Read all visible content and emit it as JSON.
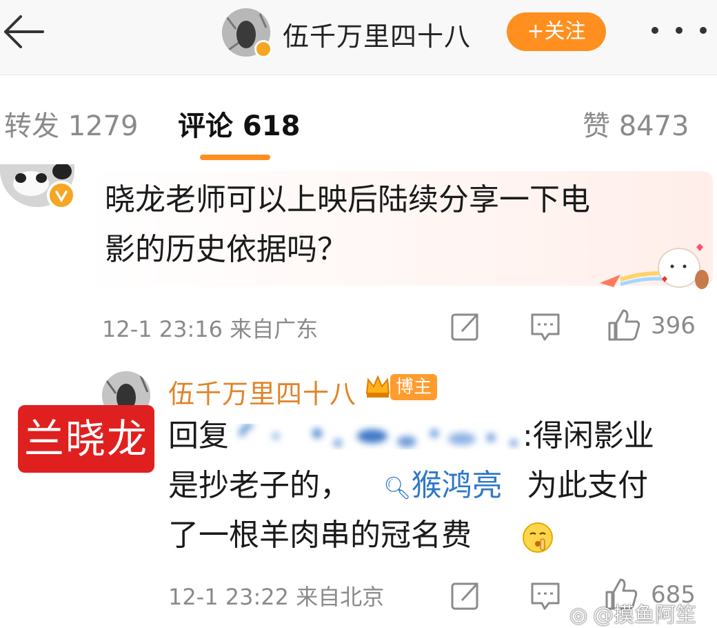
{
  "header": {
    "account_name": "伍千万里四十八",
    "follow_label": "+关注"
  },
  "tabs": {
    "repost": "转发 1279",
    "comments": "评论 618",
    "likes": "赞 8473"
  },
  "comment1": {
    "text_line1": "晓龙老师可以上映后陆续分享一下电",
    "text_line2": "影的历史依据吗？",
    "time": "12-1 23:16",
    "location": "来自广东",
    "like_count": "396"
  },
  "comment2": {
    "author": "伍千万里四十八",
    "author_badge": "博主",
    "label_tag": "兰晓龙",
    "reply_prefix": "回复",
    "reply_suffix": ":得闲影业",
    "line2_start": "是抄老子的，",
    "topic": "猴鸿亮",
    "line2_end": "为此支付",
    "line3": "了一根羊肉串的冠名费",
    "time": "12-1 23:22",
    "location": "来自北京",
    "like_count": "685"
  },
  "watermark": "@摸鱼阿笙",
  "colors": {
    "accent_orange": "#ff8f1f",
    "name_orange": "#e0832a",
    "link_blue": "#2e78c7",
    "label_red": "#e0201f",
    "meta_gray": "#8a8a8a"
  }
}
